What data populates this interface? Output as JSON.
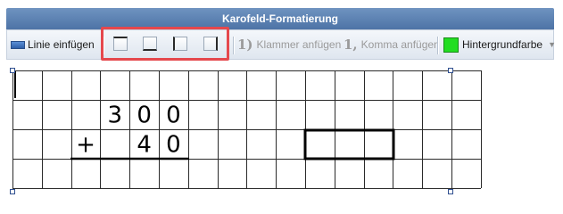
{
  "dialog": {
    "title": "Karofeld-Formatierung"
  },
  "toolbar": {
    "insert_line_label": "Linie einfügen",
    "bracket_icon_text": "1)",
    "bracket_label": "Klammer anfügen",
    "comma_icon_text": "1,",
    "comma_label": "Komma anfügen",
    "background_label": "Hintergrundfarbe",
    "background_color": "#22dd22",
    "highlight_color": "#e5484d"
  },
  "grid": {
    "rows": [
      [
        "",
        "",
        "",
        "",
        "",
        "",
        "",
        "",
        "",
        "",
        "",
        "",
        "",
        "",
        "",
        ""
      ],
      [
        "",
        "",
        "",
        "3",
        "0",
        "0",
        "",
        "",
        "",
        "",
        "",
        "",
        "",
        "",
        "",
        ""
      ],
      [
        "",
        "",
        "+",
        "",
        "4",
        "0",
        "",
        "",
        "",
        "",
        "",
        "",
        "",
        "",
        "",
        ""
      ],
      [
        "",
        "",
        "",
        "",
        "",
        "",
        "",
        "",
        "",
        "",
        "",
        "",
        "",
        "",
        "",
        ""
      ]
    ]
  }
}
